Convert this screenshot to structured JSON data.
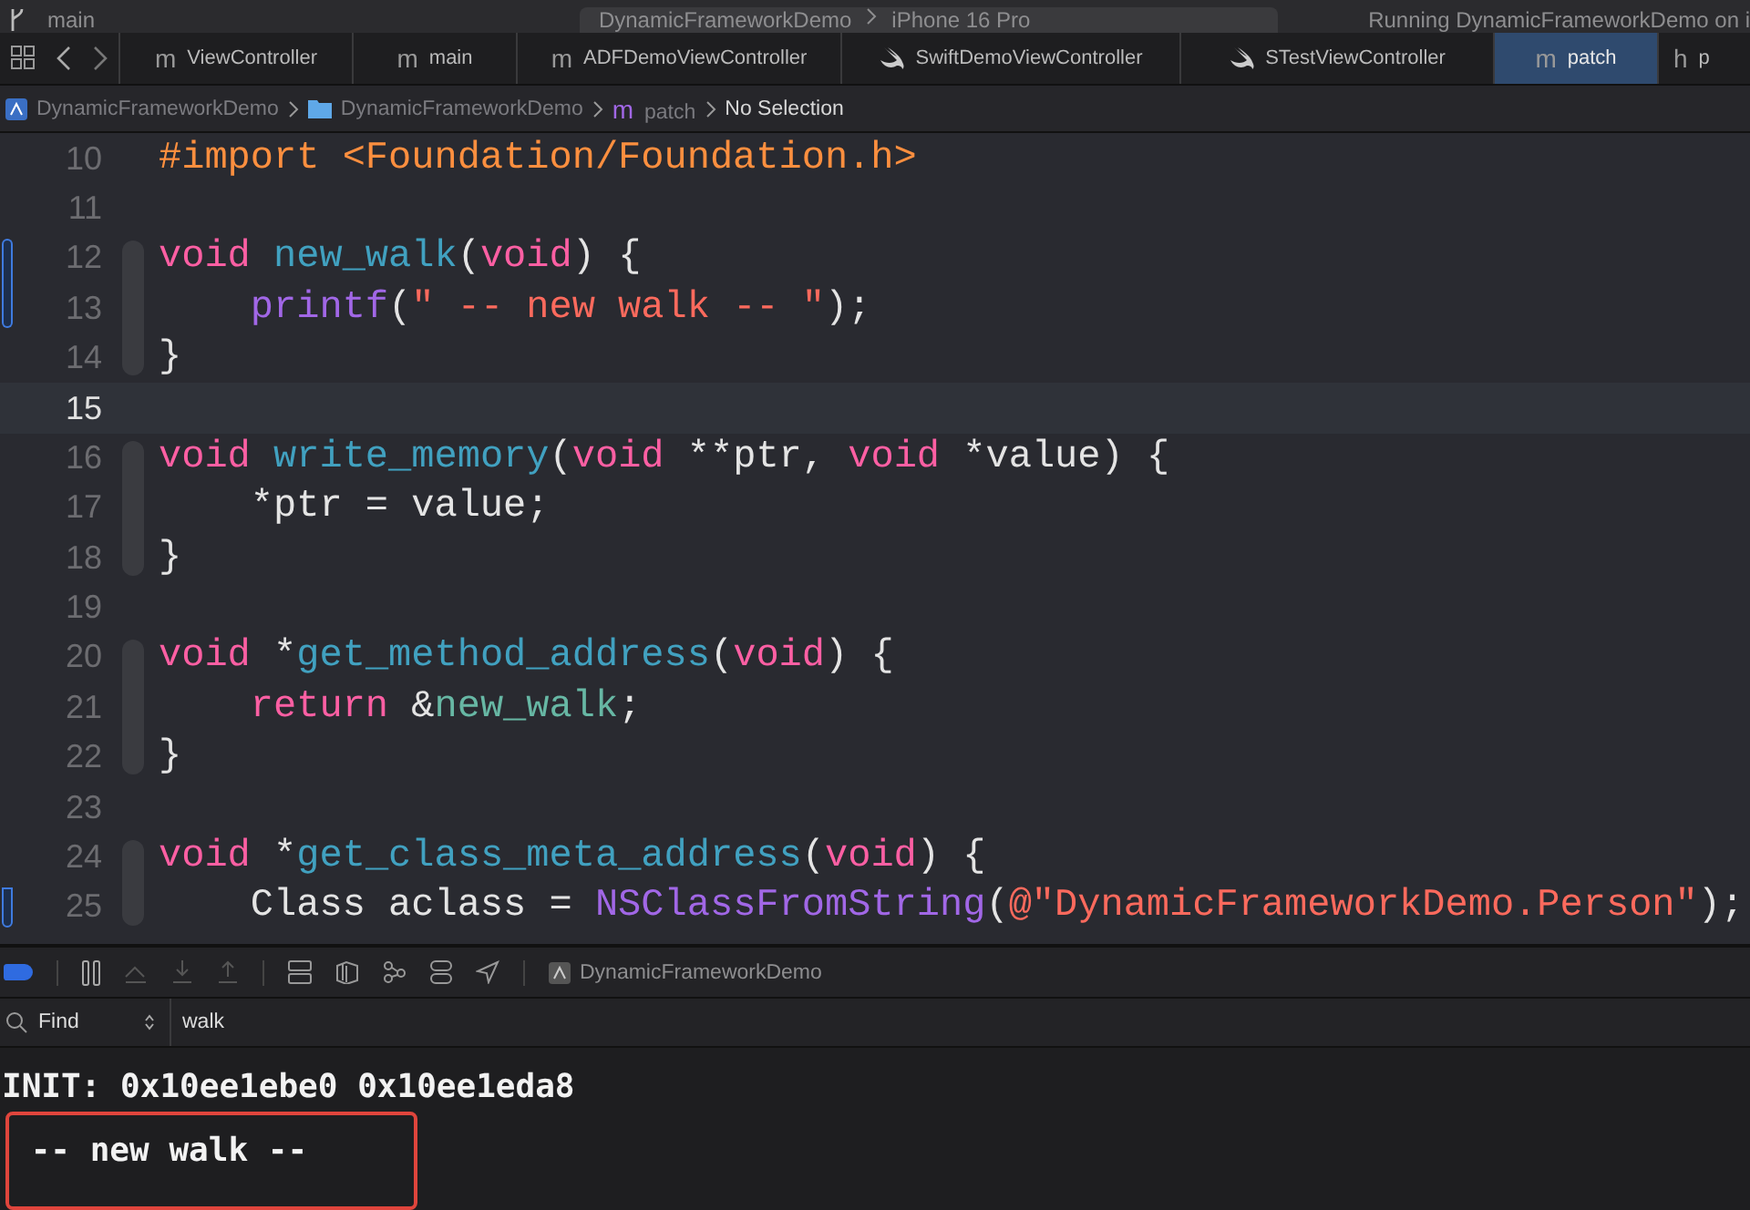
{
  "top_bar": {
    "branch": "main",
    "scheme": "DynamicFrameworkDemo",
    "device": "iPhone 16 Pro",
    "status": "Running DynamicFrameworkDemo on i"
  },
  "tabs": [
    {
      "icon": "m",
      "kind": "objc",
      "label": "ViewController",
      "selected": false
    },
    {
      "icon": "m",
      "kind": "objc",
      "label": "main",
      "selected": false
    },
    {
      "icon": "m",
      "kind": "objc",
      "label": "ADFDemoViewController",
      "selected": false
    },
    {
      "kind": "swift",
      "label": "SwiftDemoViewController",
      "selected": false
    },
    {
      "kind": "swift",
      "label": "STestViewController",
      "selected": false
    },
    {
      "icon": "m",
      "kind": "objc",
      "label": "patch",
      "selected": true
    },
    {
      "icon": "h",
      "kind": "objc",
      "label": "p",
      "selected": false
    }
  ],
  "breadcrumb": [
    {
      "kind": "project",
      "label": "DynamicFrameworkDemo"
    },
    {
      "kind": "folder",
      "label": "DynamicFrameworkDemo"
    },
    {
      "kind": "file",
      "icon": "m",
      "label": "patch"
    },
    {
      "kind": "plain",
      "label": "No Selection"
    }
  ],
  "code": [
    {
      "number": "10",
      "current": false,
      "changed": false,
      "folded": false,
      "tokens": [
        {
          "kind": "pre",
          "text": "#import <Foundation/Foundation.h>"
        }
      ]
    },
    {
      "number": "11",
      "current": false,
      "changed": false,
      "folded": false
    },
    {
      "number": "12",
      "current": false,
      "changed": true,
      "folded": true,
      "tokens": [
        {
          "kind": "kw",
          "text": "void"
        },
        {
          "kind": "decl",
          "text": " new_walk"
        },
        {
          "kind": "plain",
          "text": "("
        },
        {
          "kind": "kw",
          "text": "void"
        },
        {
          "kind": "plain",
          "text": ") {"
        }
      ]
    },
    {
      "number": "13",
      "current": false,
      "changed": true,
      "folded": true,
      "tokens": [
        {
          "kind": "sys",
          "text": "    printf"
        },
        {
          "kind": "plain",
          "text": "("
        },
        {
          "kind": "str",
          "text": "\" -- new walk -- \""
        },
        {
          "kind": "plain",
          "text": ");"
        }
      ]
    },
    {
      "number": "14",
      "current": false,
      "changed": false,
      "folded": true,
      "tokens": [
        {
          "kind": "plain",
          "text": "}"
        }
      ]
    },
    {
      "number": "15",
      "current": true,
      "changed": false,
      "folded": false
    },
    {
      "number": "16",
      "current": false,
      "changed": false,
      "folded": true,
      "tokens": [
        {
          "kind": "kw",
          "text": "void"
        },
        {
          "kind": "decl",
          "text": " write_memory"
        },
        {
          "kind": "plain",
          "text": "("
        },
        {
          "kind": "kw",
          "text": "void"
        },
        {
          "kind": "plain",
          "text": " **ptr, "
        },
        {
          "kind": "kw",
          "text": "void"
        },
        {
          "kind": "plain",
          "text": " *value) {"
        }
      ]
    },
    {
      "number": "17",
      "current": false,
      "changed": false,
      "folded": true,
      "tokens": [
        {
          "kind": "plain",
          "text": "    *ptr = value;"
        }
      ]
    },
    {
      "number": "18",
      "current": false,
      "changed": false,
      "folded": true,
      "tokens": [
        {
          "kind": "plain",
          "text": "}"
        }
      ]
    },
    {
      "number": "19",
      "current": false,
      "changed": false,
      "folded": false
    },
    {
      "number": "20",
      "current": false,
      "changed": false,
      "folded": true,
      "tokens": [
        {
          "kind": "kw",
          "text": "void"
        },
        {
          "kind": "plain",
          "text": " *"
        },
        {
          "kind": "decl",
          "text": "get_method_address"
        },
        {
          "kind": "plain",
          "text": "("
        },
        {
          "kind": "kw",
          "text": "void"
        },
        {
          "kind": "plain",
          "text": ") {"
        }
      ]
    },
    {
      "number": "21",
      "current": false,
      "changed": false,
      "folded": true,
      "tokens": [
        {
          "kind": "kw",
          "text": "    return"
        },
        {
          "kind": "plain",
          "text": " &"
        },
        {
          "kind": "call",
          "text": "new_walk"
        },
        {
          "kind": "plain",
          "text": ";"
        }
      ]
    },
    {
      "number": "22",
      "current": false,
      "changed": false,
      "folded": true,
      "tokens": [
        {
          "kind": "plain",
          "text": "}"
        }
      ]
    },
    {
      "number": "23",
      "current": false,
      "changed": false,
      "folded": false
    },
    {
      "number": "24",
      "current": false,
      "changed": false,
      "folded": true,
      "tokens": [
        {
          "kind": "kw",
          "text": "void"
        },
        {
          "kind": "plain",
          "text": " *"
        },
        {
          "kind": "decl",
          "text": "get_class_meta_address"
        },
        {
          "kind": "plain",
          "text": "("
        },
        {
          "kind": "kw",
          "text": "void"
        },
        {
          "kind": "plain",
          "text": ") {"
        }
      ]
    },
    {
      "number": "25",
      "current": false,
      "changed": true,
      "folded": true,
      "tokens": [
        {
          "kind": "plain",
          "text": "    Class aclass = "
        },
        {
          "kind": "sys",
          "text": "NSClassFromString"
        },
        {
          "kind": "plain",
          "text": "("
        },
        {
          "kind": "str",
          "text": "@\"DynamicFrameworkDemo.Person\""
        },
        {
          "kind": "plain",
          "text": ");"
        }
      ]
    }
  ],
  "debug_bar": {
    "breakpoints_active": true,
    "target": "DynamicFrameworkDemo"
  },
  "find_bar": {
    "mode": "Find",
    "value": "walk"
  },
  "console": [
    {
      "text": "INIT: 0x10ee1ebe0 0x10ee1eda8",
      "highlighted": false
    },
    {
      "text": " -- new walk --",
      "highlighted": true
    }
  ]
}
